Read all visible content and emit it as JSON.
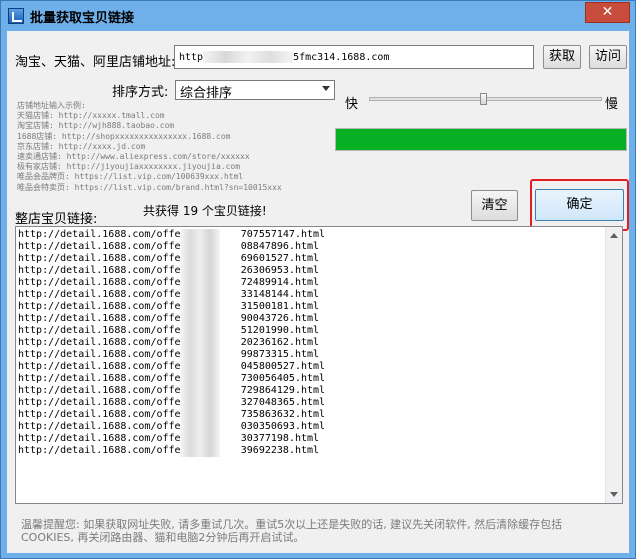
{
  "window": {
    "title": "批量获取宝贝链接",
    "close_glyph": "✕"
  },
  "shop": {
    "label": "淘宝、天猫、阿里店铺地址:",
    "url_prefix": "http",
    "url_suffix": "5fmc314.1688.com",
    "fetch_label": "获取",
    "visit_label": "访问"
  },
  "sort": {
    "label": "排序方式:",
    "selected": "综合排序"
  },
  "examples": [
    "店铺地址输入示例:",
    "天猫店铺: http://xxxxx.tmall.com",
    "淘宝店铺: http://wjh888.taobao.com",
    "1688店铺: http://shopxxxxxxxxxxxxxxx.1688.com",
    "京东店铺: http://xxxx.jd.com",
    "速卖通店铺: http://www.aliexpress.com/store/xxxxxx",
    "极有家店铺: http://jiyoujiaxxxxxxxx.jiyoujia.com",
    "唯品会品牌页: https://list.vip.com/100639xxx.html",
    "唯品会特卖页: https://list.vip.com/brand.html?sn=10015xxx"
  ],
  "speed": {
    "fast_label": "快",
    "slow_label": "慢",
    "level_fraction": 0.49
  },
  "progress": {
    "fraction": 1.0,
    "color": "#06b025"
  },
  "result": {
    "list_label": "整店宝贝链接:",
    "count_text": "共获得 19 个宝贝链接!",
    "clear_label": "清空",
    "confirm_label": "确定",
    "links": [
      "http://detail.1688.com/offe          707557147.html",
      "http://detail.1688.com/offe          08847896.html",
      "http://detail.1688.com/offe          69601527.html",
      "http://detail.1688.com/offe          26306953.html",
      "http://detail.1688.com/offe          72489914.html",
      "http://detail.1688.com/offe          33148144.html",
      "http://detail.1688.com/offe          31500181.html",
      "http://detail.1688.com/offe          90043726.html",
      "http://detail.1688.com/offe          51201990.html",
      "http://detail.1688.com/offe          20236162.html",
      "http://detail.1688.com/offe          99873315.html",
      "http://detail.1688.com/offe          045800527.html",
      "http://detail.1688.com/offe          730056405.html",
      "http://detail.1688.com/offe          729864129.html",
      "http://detail.1688.com/offe          327048365.html",
      "http://detail.1688.com/offe          735863632.html",
      "http://detail.1688.com/offe          030350693.html",
      "http://detail.1688.com/offe          30377198.html",
      "http://detail.1688.com/offe          39692238.html"
    ]
  },
  "tip": {
    "text": "温馨提醒您: 如果获取网址失败, 请多重试几次。重试5次以上还是失败的话, 建议先关闭软件, 然后清除缓存包括COOKIES, 再关闭路由器、猫和电脑2分钟后再开启试试。"
  }
}
